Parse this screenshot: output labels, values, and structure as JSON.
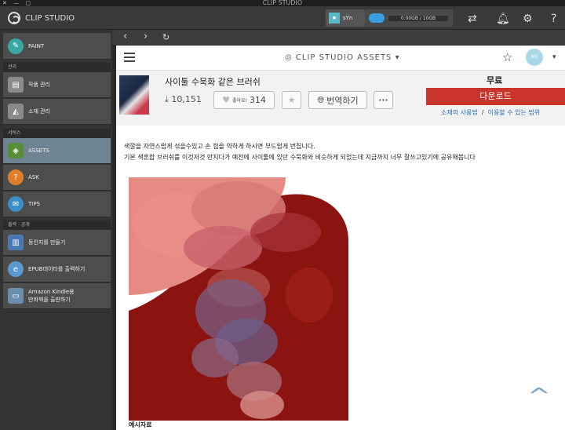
{
  "window": {
    "title": "CLIP STUDIO"
  },
  "topbar": {
    "logo_label": "CLIP STUDIO",
    "user_name": "sYn",
    "cloud_storage": "0.00GB / 10GB"
  },
  "sidebar": {
    "items": [
      {
        "label": "PAINT",
        "icon": "paint-icon",
        "color": "#3aa7a3"
      },
      {
        "section": "관리"
      },
      {
        "label": "작품 관리",
        "icon": "artwork-manage-icon",
        "color": "#8a8a8a"
      },
      {
        "label": "소재 관리",
        "icon": "material-manage-icon",
        "color": "#8a8a8a"
      },
      {
        "section": "서비스"
      },
      {
        "label": "ASSETS",
        "icon": "assets-icon",
        "color": "#5a8f3a",
        "active": true
      },
      {
        "label": "ASK",
        "icon": "ask-icon",
        "color": "#e07f2a"
      },
      {
        "label": "TIPS",
        "icon": "tips-icon",
        "color": "#3b8ec8"
      },
      {
        "section": "출력 · 공개"
      },
      {
        "label": "동인지를 만들기",
        "icon": "doujinshi-icon",
        "color": "#4a78b5"
      },
      {
        "label": "EPUB데이터를 출력하기",
        "icon": "epub-icon",
        "color": "#5a9ad0"
      },
      {
        "label": "Amazon Kindle용\n만화책을 출판하기",
        "icon": "kindle-icon",
        "color": "#6c8fb0"
      }
    ]
  },
  "nav": {
    "back": "‹",
    "forward": "›",
    "reload": "↻"
  },
  "content": {
    "brand": "CLIP STUDIO ASSETS",
    "avatar_label": "NO IMAGE",
    "asset": {
      "title": "사이툴 수묵화 같은 브러쉬",
      "downloads": "10,151",
      "like_label": "좋아요!",
      "likes": "314",
      "translate_label": "번역하기",
      "more_label": "•••",
      "price": "무료",
      "download_button": "다운로드",
      "link_usage": "소재의 사용법",
      "link_scope": "이용할 수 있는 범위"
    },
    "description": [
      "색깔을 자연스럽게 섞을수있고 손 힘을 약하게 하시면 부드럽게 번집니다.",
      "기본 색혼합 브러쉬를 이것저것 만지다가 예전에 사이툴에 있던 수묵화와 비슷하게 되었는데 지금까지 너무 잘쓰고있기에 공유해봅니다"
    ],
    "caption": "예시자료"
  },
  "colors": {
    "accent": "#c9342a",
    "active_sidebar": "#6f8493",
    "link": "#2a6bbf"
  }
}
